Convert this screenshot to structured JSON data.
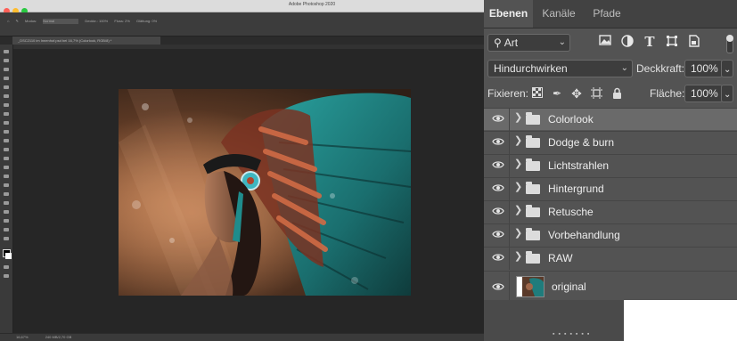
{
  "app": {
    "window_title": "Adobe Photoshop 2020",
    "document_tab": "_DSC2110 im Innenhof.psd bei 16,7% (Colorlook, RGB/8) *",
    "options_bar": [
      "Modus:",
      "Normal",
      "Deckkr.: 100%",
      "Fluss: 2%",
      "Glättung: 0%"
    ],
    "status_bar": [
      "16,67%",
      "240 MB/2,70 GB"
    ]
  },
  "panel": {
    "tabs": [
      {
        "label": "Ebenen",
        "active": true
      },
      {
        "label": "Kanäle",
        "active": false
      },
      {
        "label": "Pfade",
        "active": false
      }
    ],
    "filter": {
      "value": "Art"
    },
    "blend_mode": {
      "value": "Hindurchwirken"
    },
    "opacity": {
      "label": "Deckkraft:",
      "value": "100%"
    },
    "lock_label": "Fixieren:",
    "fill": {
      "label": "Fläche:",
      "value": "100%"
    },
    "filter_icons": [
      "image-filter-icon",
      "adjustment-filter-icon",
      "type-filter-icon",
      "shape-filter-icon",
      "smart-object-filter-icon"
    ],
    "lock_icons": [
      "lock-transparent-icon",
      "lock-image-icon",
      "lock-position-icon",
      "lock-artboard-icon",
      "lock-all-icon"
    ],
    "layers": [
      {
        "name": "Colorlook",
        "type": "group",
        "selected": true
      },
      {
        "name": "Dodge & burn",
        "type": "group",
        "selected": false
      },
      {
        "name": "Lichtstrahlen",
        "type": "group",
        "selected": false
      },
      {
        "name": "Hintergrund",
        "type": "group",
        "selected": false
      },
      {
        "name": "Retusche",
        "type": "group",
        "selected": false
      },
      {
        "name": "Vorbehandlung",
        "type": "group",
        "selected": false
      },
      {
        "name": "RAW",
        "type": "group",
        "selected": false
      }
    ],
    "base_layer": {
      "name": "original"
    }
  },
  "colors": {
    "panel_bg": "#535353",
    "selected_layer": "#6a6a6a",
    "workspace": "#262626",
    "feather_teal": "#1f8c8c"
  }
}
